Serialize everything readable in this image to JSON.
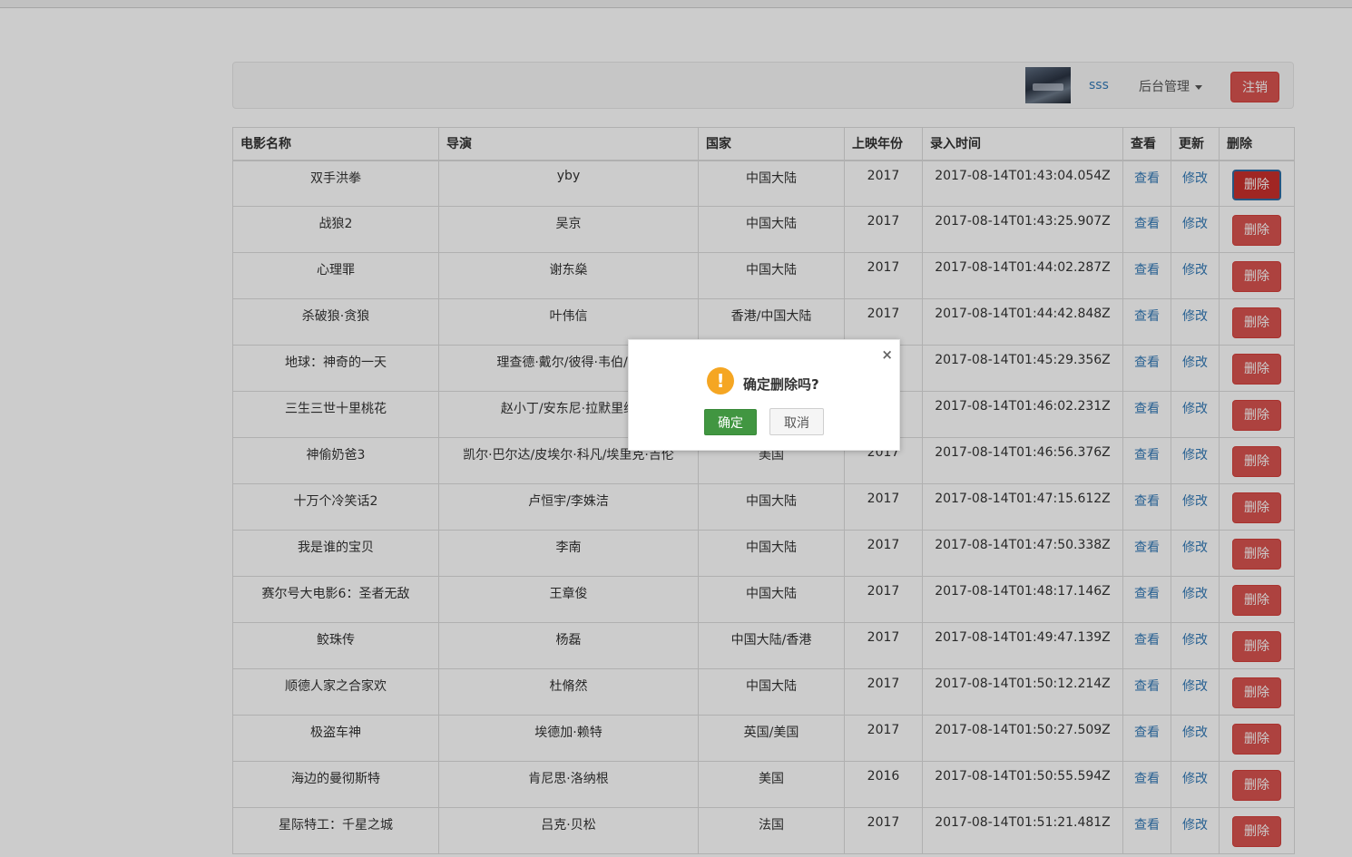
{
  "navbar": {
    "username": "sss",
    "admin_menu_label": "后台管理",
    "logout_label": "注销"
  },
  "table": {
    "headers": [
      "电影名称",
      "导演",
      "国家",
      "上映年份",
      "录入时间",
      "查看",
      "更新",
      "删除"
    ],
    "rows": [
      {
        "title": "双手洪拳",
        "director": "yby",
        "country": "中国大陆",
        "year": "2017",
        "created": "2017-08-14T01:43:04.054Z",
        "view": "查看",
        "edit": "修改",
        "delete": "删除"
      },
      {
        "title": "战狼2",
        "director": "吴京",
        "country": "中国大陆",
        "year": "2017",
        "created": "2017-08-14T01:43:25.907Z",
        "view": "查看",
        "edit": "修改",
        "delete": "删除"
      },
      {
        "title": "心理罪",
        "director": "谢东燊",
        "country": "中国大陆",
        "year": "2017",
        "created": "2017-08-14T01:44:02.287Z",
        "view": "查看",
        "edit": "修改",
        "delete": "删除"
      },
      {
        "title": "杀破狼·贪狼",
        "director": "叶伟信",
        "country": "香港/中国大陆",
        "year": "2017",
        "created": "2017-08-14T01:44:42.848Z",
        "view": "查看",
        "edit": "修改",
        "delete": "删除"
      },
      {
        "title": "地球：神奇的一天",
        "director": "理查德·戴尔/彼得·韦伯/范",
        "country": "",
        "year": "",
        "created": "2017-08-14T01:45:29.356Z",
        "view": "查看",
        "edit": "修改",
        "delete": "删除"
      },
      {
        "title": "三生三世十里桃花",
        "director": "赵小丁/安东尼·拉默里纳",
        "country": "",
        "year": "",
        "created": "2017-08-14T01:46:02.231Z",
        "view": "查看",
        "edit": "修改",
        "delete": "删除"
      },
      {
        "title": "神偷奶爸3",
        "director": "凯尔·巴尔达/皮埃尔·科凡/埃里克·吉伦",
        "country": "美国",
        "year": "2017",
        "created": "2017-08-14T01:46:56.376Z",
        "view": "查看",
        "edit": "修改",
        "delete": "删除"
      },
      {
        "title": "十万个冷笑话2",
        "director": "卢恒宇/李姝洁",
        "country": "中国大陆",
        "year": "2017",
        "created": "2017-08-14T01:47:15.612Z",
        "view": "查看",
        "edit": "修改",
        "delete": "删除"
      },
      {
        "title": "我是谁的宝贝",
        "director": "李南",
        "country": "中国大陆",
        "year": "2017",
        "created": "2017-08-14T01:47:50.338Z",
        "view": "查看",
        "edit": "修改",
        "delete": "删除"
      },
      {
        "title": "赛尔号大电影6：圣者无敌",
        "director": "王章俊",
        "country": "中国大陆",
        "year": "2017",
        "created": "2017-08-14T01:48:17.146Z",
        "view": "查看",
        "edit": "修改",
        "delete": "删除"
      },
      {
        "title": "鲛珠传",
        "director": "杨磊",
        "country": "中国大陆/香港",
        "year": "2017",
        "created": "2017-08-14T01:49:47.139Z",
        "view": "查看",
        "edit": "修改",
        "delete": "删除"
      },
      {
        "title": "顺德人家之合家欢",
        "director": "杜脩然",
        "country": "中国大陆",
        "year": "2017",
        "created": "2017-08-14T01:50:12.214Z",
        "view": "查看",
        "edit": "修改",
        "delete": "删除"
      },
      {
        "title": "极盗车神",
        "director": "埃德加·赖特",
        "country": "英国/美国",
        "year": "2017",
        "created": "2017-08-14T01:50:27.509Z",
        "view": "查看",
        "edit": "修改",
        "delete": "删除"
      },
      {
        "title": "海边的曼彻斯特",
        "director": "肯尼思·洛纳根",
        "country": "美国",
        "year": "2016",
        "created": "2017-08-14T01:50:55.594Z",
        "view": "查看",
        "edit": "修改",
        "delete": "删除"
      },
      {
        "title": "星际特工：千星之城",
        "director": "吕克·贝松",
        "country": "法国",
        "year": "2017",
        "created": "2017-08-14T01:51:21.481Z",
        "view": "查看",
        "edit": "修改",
        "delete": "删除"
      }
    ]
  },
  "dialog": {
    "icon": "warning-icon",
    "close_symbol": "×",
    "message": "确定删除吗?",
    "confirm_label": "确定",
    "cancel_label": "取消"
  }
}
